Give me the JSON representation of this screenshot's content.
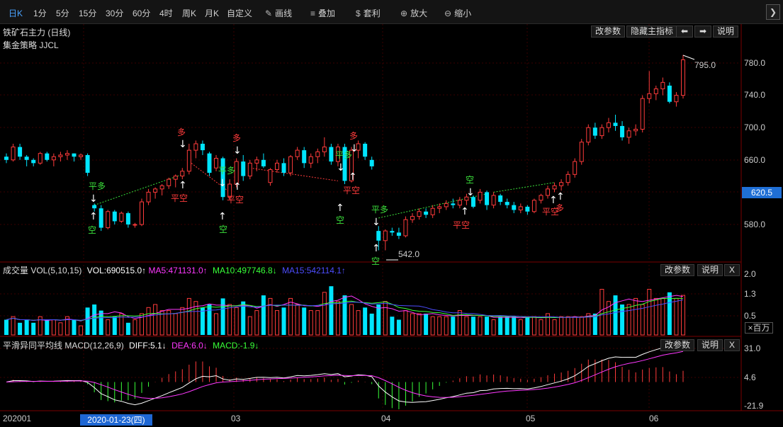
{
  "toolbar": {
    "periods": [
      "日K",
      "1分",
      "5分",
      "15分",
      "30分",
      "60分",
      "4时",
      "周K",
      "月K",
      "自定义"
    ],
    "active_period": "日K",
    "tools": [
      {
        "label": "画线",
        "icon": "pencil-icon",
        "glyph": "✎"
      },
      {
        "label": "叠加",
        "icon": "stack-icon",
        "glyph": "≡"
      },
      {
        "label": "套利",
        "icon": "money-bag-icon",
        "glyph": "$"
      },
      {
        "label": "放大",
        "icon": "zoom-in-icon",
        "glyph": "⊕"
      },
      {
        "label": "缩小",
        "icon": "zoom-out-icon",
        "glyph": "⊖"
      }
    ],
    "next_glyph": "❯"
  },
  "main": {
    "title": "铁矿石主力 (日线)",
    "subtitle": "集金策略 JJCL",
    "buttons": {
      "params": "改参数",
      "hide": "隐藏主指标",
      "prev": "⬅",
      "next": "➡",
      "help": "说明"
    },
    "price_axis": [
      "780.0",
      "740.0",
      "700.0",
      "660.0",
      "620.5",
      "580.0"
    ],
    "current_price": "620.5",
    "high_label": "795.0",
    "low_label": "542.0",
    "signals": {
      "duo": "多",
      "kong": "空",
      "ping_duo": "平多",
      "ping_kong": "平空"
    }
  },
  "volume": {
    "title": "成交量 VOL(5,10,15)",
    "vol": "VOL:690515.0↑",
    "ma5": "MA5:471131.0↑",
    "ma10": "MA10:497746.8↓",
    "ma15": "MA15:542114.1↑",
    "axis": [
      "2.0",
      "1.3",
      "0.5"
    ],
    "unit": "×百万",
    "buttons": {
      "params": "改参数",
      "help": "说明",
      "close": "X"
    }
  },
  "macd": {
    "title": "平滑异同平均线 MACD(12,26,9)",
    "diff": "DIFF:5.1↓",
    "dea": "DEA:6.0↓",
    "macd": "MACD:-1.9↓",
    "axis": [
      "31.0",
      "4.6",
      "-21.9"
    ],
    "buttons": {
      "params": "改参数",
      "help": "说明",
      "close": "X"
    }
  },
  "xaxis": {
    "labels": [
      "202001",
      "03",
      "04",
      "05",
      "06"
    ],
    "cursor_date": "2020-01-23(四)"
  },
  "colors": {
    "up": "#ff3b3b",
    "down": "#00e5ff",
    "ma5": "#ff38ff",
    "ma10": "#38ff38",
    "ma15": "#4d4dff",
    "grid": "#5a0000",
    "accent": "#1f6fd6"
  },
  "chart_data": {
    "type": "candlestick",
    "title": "铁矿石主力 (日线)",
    "candles_ohlc": [
      [
        664,
        668,
        656,
        660
      ],
      [
        660,
        680,
        658,
        676
      ],
      [
        676,
        680,
        660,
        664
      ],
      [
        664,
        666,
        652,
        660
      ],
      [
        660,
        662,
        652,
        656
      ],
      [
        656,
        670,
        654,
        668
      ],
      [
        668,
        670,
        658,
        660
      ],
      [
        660,
        668,
        652,
        664
      ],
      [
        664,
        670,
        658,
        666
      ],
      [
        666,
        672,
        660,
        668
      ],
      [
        668,
        668,
        658,
        664
      ],
      [
        664,
        668,
        660,
        666
      ],
      [
        666,
        668,
        640,
        644
      ],
      [
        604,
        606,
        596,
        600
      ],
      [
        600,
        604,
        572,
        576
      ],
      [
        576,
        598,
        574,
        596
      ],
      [
        596,
        598,
        580,
        584
      ],
      [
        584,
        596,
        582,
        594
      ],
      [
        594,
        596,
        576,
        580
      ],
      [
        580,
        582,
        576,
        580
      ],
      [
        580,
        612,
        578,
        608
      ],
      [
        608,
        624,
        604,
        620
      ],
      [
        620,
        626,
        612,
        624
      ],
      [
        624,
        630,
        616,
        628
      ],
      [
        628,
        638,
        624,
        636
      ],
      [
        636,
        642,
        626,
        640
      ],
      [
        640,
        650,
        636,
        646
      ],
      [
        646,
        680,
        642,
        672
      ],
      [
        672,
        684,
        662,
        680
      ],
      [
        680,
        684,
        666,
        672
      ],
      [
        668,
        670,
        640,
        644
      ],
      [
        650,
        666,
        646,
        662
      ],
      [
        662,
        664,
        610,
        614
      ],
      [
        614,
        636,
        610,
        630
      ],
      [
        630,
        662,
        626,
        658
      ],
      [
        658,
        666,
        634,
        640
      ],
      [
        640,
        660,
        636,
        656
      ],
      [
        656,
        664,
        646,
        660
      ],
      [
        660,
        668,
        650,
        652
      ],
      [
        632,
        650,
        628,
        648
      ],
      [
        648,
        660,
        644,
        656
      ],
      [
        656,
        662,
        640,
        644
      ],
      [
        644,
        666,
        640,
        664
      ],
      [
        664,
        676,
        660,
        672
      ],
      [
        672,
        676,
        650,
        656
      ],
      [
        656,
        668,
        650,
        664
      ],
      [
        664,
        674,
        656,
        670
      ],
      [
        670,
        688,
        664,
        676
      ],
      [
        676,
        680,
        654,
        658
      ],
      [
        658,
        680,
        652,
        676
      ],
      [
        676,
        680,
        630,
        634
      ],
      [
        634,
        676,
        632,
        672
      ],
      [
        672,
        684,
        662,
        680
      ],
      [
        680,
        682,
        660,
        664
      ],
      [
        660,
        664,
        648,
        652
      ],
      [
        572,
        578,
        548,
        560
      ],
      [
        560,
        574,
        548,
        572
      ],
      [
        572,
        576,
        566,
        570
      ],
      [
        570,
        576,
        562,
        566
      ],
      [
        566,
        590,
        564,
        586
      ],
      [
        586,
        594,
        582,
        590
      ],
      [
        590,
        600,
        586,
        596
      ],
      [
        596,
        600,
        588,
        592
      ],
      [
        592,
        604,
        588,
        600
      ],
      [
        600,
        606,
        594,
        602
      ],
      [
        602,
        610,
        598,
        606
      ],
      [
        606,
        612,
        600,
        604
      ],
      [
        604,
        614,
        600,
        610
      ],
      [
        610,
        618,
        604,
        614
      ],
      [
        614,
        616,
        600,
        602
      ],
      [
        610,
        624,
        606,
        620
      ],
      [
        620,
        622,
        598,
        604
      ],
      [
        604,
        620,
        600,
        616
      ],
      [
        616,
        618,
        604,
        608
      ],
      [
        608,
        612,
        600,
        604
      ],
      [
        604,
        608,
        594,
        598
      ],
      [
        598,
        606,
        594,
        602
      ],
      [
        602,
        604,
        592,
        596
      ],
      [
        596,
        612,
        594,
        610
      ],
      [
        610,
        618,
        606,
        616
      ],
      [
        616,
        628,
        612,
        624
      ],
      [
        624,
        632,
        620,
        628
      ],
      [
        628,
        636,
        622,
        632
      ],
      [
        632,
        646,
        628,
        642
      ],
      [
        642,
        662,
        638,
        658
      ],
      [
        658,
        686,
        654,
        682
      ],
      [
        682,
        704,
        678,
        700
      ],
      [
        700,
        706,
        686,
        690
      ],
      [
        690,
        704,
        686,
        700
      ],
      [
        700,
        712,
        694,
        706
      ],
      [
        706,
        716,
        696,
        702
      ],
      [
        702,
        708,
        684,
        688
      ],
      [
        688,
        700,
        680,
        696
      ],
      [
        696,
        704,
        690,
        698
      ],
      [
        698,
        740,
        694,
        736
      ],
      [
        736,
        770,
        730,
        742
      ],
      [
        742,
        752,
        734,
        748
      ],
      [
        748,
        762,
        740,
        756
      ],
      [
        752,
        756,
        730,
        732
      ],
      [
        732,
        744,
        726,
        740
      ],
      [
        740,
        790,
        736,
        784
      ]
    ],
    "volume_millions": [
      0.5,
      0.6,
      0.4,
      0.5,
      0.4,
      0.6,
      0.5,
      0.5,
      0.4,
      0.6,
      0.5,
      0.3,
      0.9,
      1.0,
      0.8,
      0.5,
      0.6,
      0.7,
      0.4,
      0.5,
      0.7,
      0.9,
      1.0,
      0.8,
      0.8,
      0.7,
      0.9,
      1.2,
      1.1,
      0.9,
      1.0,
      0.7,
      1.2,
      1.0,
      0.9,
      1.1,
      0.6,
      0.8,
      1.3,
      1.2,
      0.8,
      0.9,
      1.2,
      1.0,
      0.9,
      0.8,
      0.8,
      1.4,
      1.6,
      1.1,
      1.3,
      1.0,
      0.8,
      0.9,
      0.7,
      1.0,
      1.1,
      0.6,
      0.5,
      0.8,
      0.7,
      0.7,
      0.7,
      0.6,
      0.6,
      0.6,
      0.6,
      0.8,
      0.6,
      0.6,
      0.6,
      0.6,
      0.5,
      0.6,
      0.6,
      0.6,
      0.5,
      0.6,
      0.6,
      0.5,
      0.7,
      0.5,
      0.6,
      0.6,
      0.6,
      0.6,
      0.7,
      0.7,
      1.5,
      1.1,
      1.3,
      1.0,
      1.0,
      1.2,
      1.0,
      1.5,
      1.2,
      1.2,
      1.4,
      1.2,
      1.3
    ]
  }
}
